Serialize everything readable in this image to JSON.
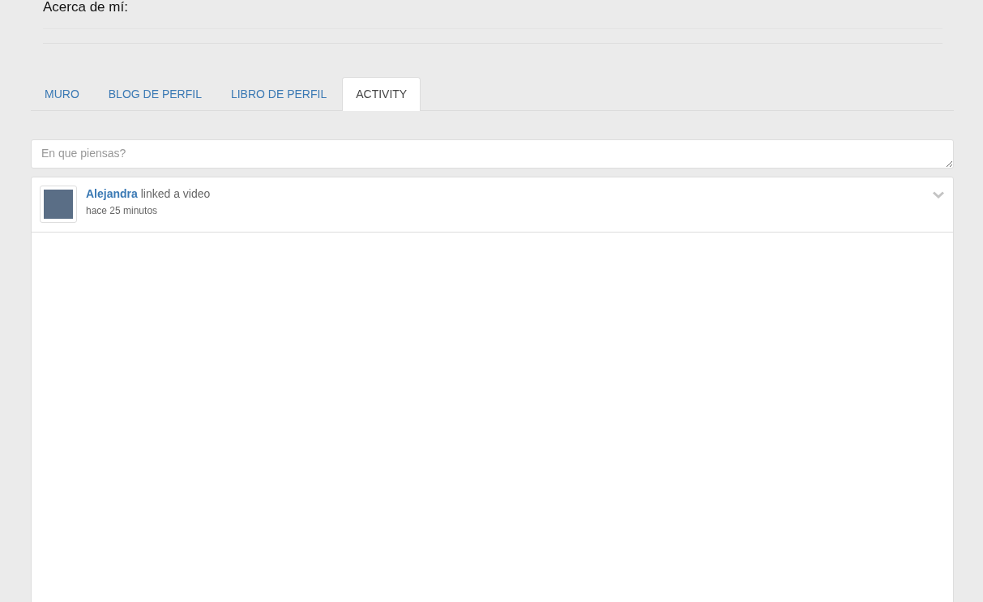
{
  "about": {
    "heading": "Acerca de mí:"
  },
  "tabs": [
    {
      "label": "MURO",
      "selected": false
    },
    {
      "label": "BLOG DE PERFIL",
      "selected": false
    },
    {
      "label": "LIBRO DE PERFIL",
      "selected": false
    },
    {
      "label": "ACTIVITY",
      "selected": true
    }
  ],
  "composer": {
    "placeholder": "En que piensas?"
  },
  "feed": [
    {
      "author": "Alejandra",
      "action": "linked a video",
      "time": "hace 25 minutos"
    }
  ]
}
